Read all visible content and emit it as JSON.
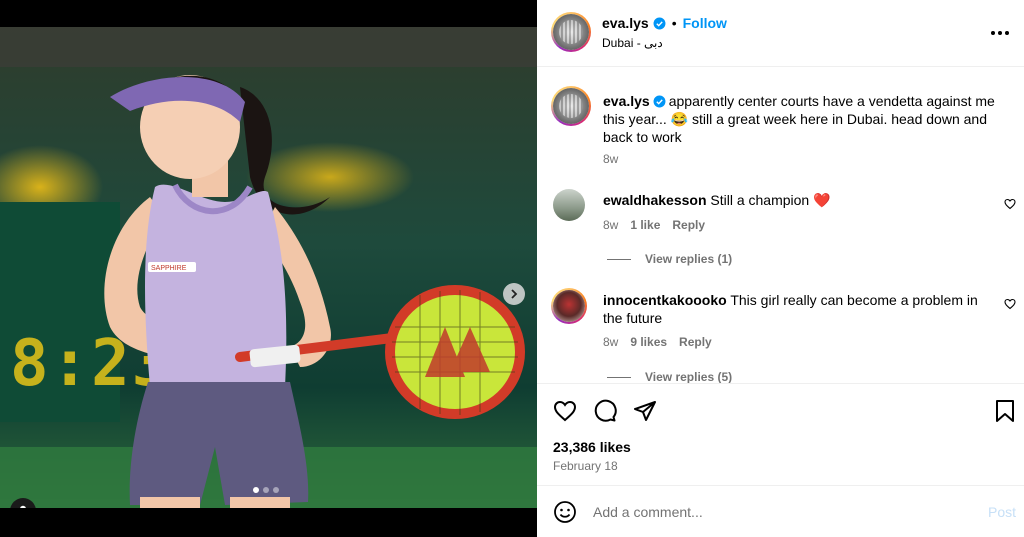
{
  "post": {
    "author": "eva.lys",
    "location": "Dubai - دبی",
    "follow_label": "Follow",
    "caption": "apparently center courts have a vendetta against me this year... 😂 still a great week here in Dubai. head down and back to work",
    "caption_age": "8w",
    "likes": "23,386 likes",
    "date": "February 18"
  },
  "media": {
    "scoreboard_text": "8:23",
    "carousel_dots": 3,
    "active_dot": 0,
    "shirt_logo": "SAPPHIRE"
  },
  "comments": [
    {
      "username": "ewaldhakesson",
      "text": "Still a champion",
      "emoji": "❤️",
      "age": "8w",
      "likes": "1 like",
      "reply": "Reply",
      "view_replies": "View replies (1)"
    },
    {
      "username": "innocentkakoooko",
      "text": "This girl really can become a problem in the future",
      "age": "8w",
      "likes": "9 likes",
      "reply": "Reply",
      "view_replies": "View replies (5)"
    }
  ],
  "comment_box": {
    "placeholder": "Add a comment...",
    "post_label": "Post"
  },
  "icons": {
    "verified": "verified-badge-icon",
    "more": "more-options-icon",
    "like": "heart-icon",
    "comment": "comment-icon",
    "share": "share-icon",
    "save": "bookmark-icon",
    "emoji": "emoji-icon",
    "next": "chevron-right-icon",
    "user_tag": "user-tag-icon"
  },
  "colors": {
    "accent": "#0095f6",
    "secondary_text": "#737373",
    "heart_red": "#ed4956"
  }
}
